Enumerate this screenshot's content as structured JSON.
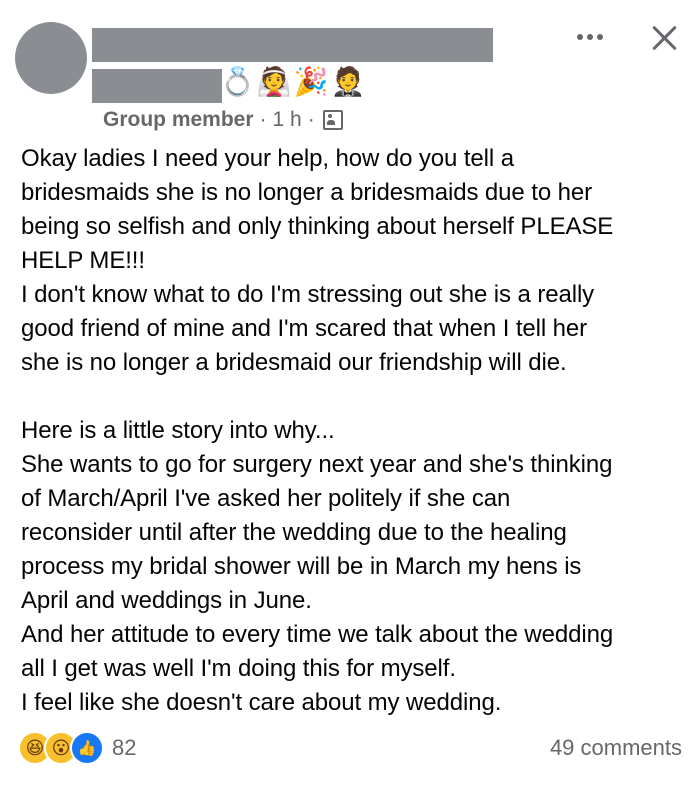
{
  "header": {
    "role": "Group member",
    "time": "1 h",
    "separator": "·",
    "emojis": [
      "💍",
      "👰",
      "🎉",
      "🤵"
    ]
  },
  "post": {
    "lines_block1": [
      "Okay ladies I need your help, how do you tell a",
      "bridesmaids she is no longer a bridesmaids due to her",
      "being so selfish and only thinking about herself PLEASE",
      "HELP ME!!!",
      "I don't know what to do I'm stressing out she is a really",
      "good friend of mine and I'm scared that when I tell her",
      "she is no longer a bridesmaid our friendship will die."
    ],
    "lines_block2": [
      "Here is a little story into why...",
      "She wants to go for surgery next year and she's thinking",
      "of March/April I've asked her politely if she can",
      "reconsider until after the wedding due to the healing",
      "process my bridal shower will be in March my hens is",
      "April and weddings in June.",
      "And her attitude to every time we talk about the wedding",
      "all I get was well I'm doing this for myself.",
      "I feel like she doesn't care about my wedding."
    ]
  },
  "footer": {
    "reaction_icons": [
      "😆",
      "😮",
      "👍"
    ],
    "reaction_count": "82",
    "comments": "49 comments"
  },
  "colors": {
    "muted": "#65676b",
    "redaction": "#8a8d91",
    "like_blue": "#1877f2",
    "emoji_yellow": "#f7c02c"
  }
}
